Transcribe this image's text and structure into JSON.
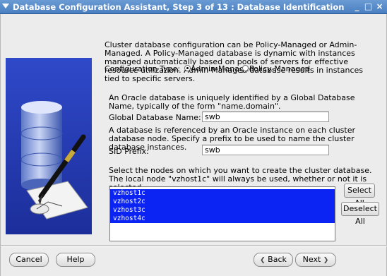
{
  "window": {
    "title": "Database Configuration Assistant, Step 3 of 13 : Database Identification",
    "controls": [
      "_",
      "□",
      "×"
    ]
  },
  "intro": "Cluster database configuration can be Policy-Managed or Admin-Managed. A Policy-Managed database is dynamic with instances managed automatically based on pools of servers for effective resource utilization. Admin-Managed database results in instances tied to specific servers.",
  "config_type": {
    "label": "Configuration Type:",
    "options": [
      "Admin-Managed",
      "Policy-Managed"
    ],
    "selected": "Admin-Managed"
  },
  "gdb": {
    "help": "An Oracle database is uniquely identified by a Global Database Name, typically of the form \"name.domain\".",
    "label": "Global Database Name:",
    "value": "swb"
  },
  "sid": {
    "help": "A database is referenced by an Oracle instance on each cluster database node. Specify a prefix to be used to name the cluster database instances.",
    "label": "SID Prefix:",
    "value": "swb"
  },
  "nodes": {
    "help": "Select the nodes on which you want to create the cluster database. The local node \"vzhost1c\" will always be used, whether or not it is selected.",
    "items": [
      "vzhost1c",
      "vzhost2c",
      "vzhost3c",
      "vzhost4c"
    ],
    "select_all": "Select All",
    "deselect_all": "Deselect All"
  },
  "footer": {
    "cancel": "Cancel",
    "help": "Help",
    "back": "Back",
    "next": "Next"
  }
}
